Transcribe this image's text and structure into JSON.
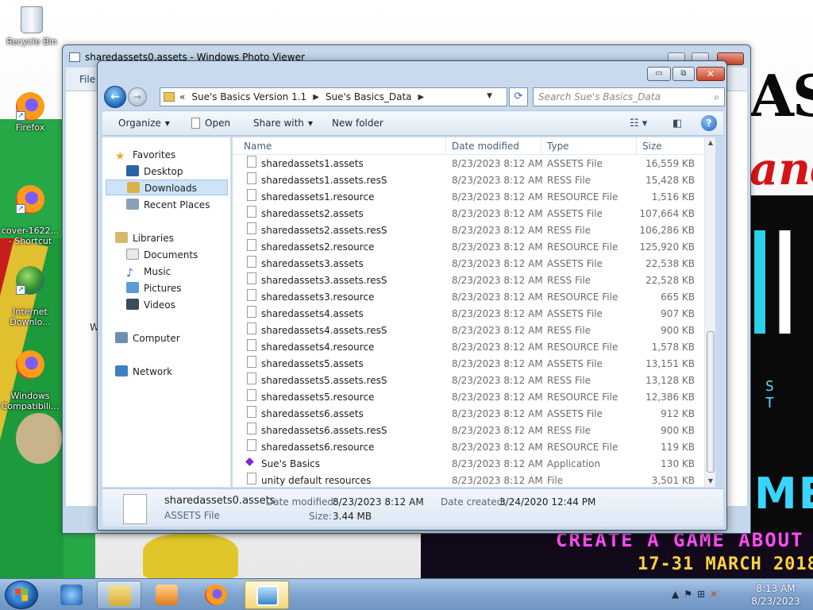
{
  "desktop": {
    "icons": [
      {
        "label": "Recycle Bin"
      },
      {
        "label": "Firefox"
      },
      {
        "label": "cover-1622...\n- Shortcut"
      },
      {
        "label": "Internet\nDownlo..."
      },
      {
        "label": "Windows\nCompatibili..."
      }
    ],
    "wallpaper_text": {
      "line1": "AS",
      "line2": "and",
      "letters": "S T",
      "me": "ME",
      "banner1": "CREATE A GAME ABOUT",
      "banner2": "17-31 MARCH 2018"
    }
  },
  "photo_viewer": {
    "title": "sharedassets0.assets - Windows Photo Viewer",
    "menu_file": "File",
    "partial_label": "W"
  },
  "explorer": {
    "window_buttons": {
      "minimize": "▭",
      "maximize": "⧉",
      "close": "✕"
    },
    "address": {
      "overflow": "«",
      "crumbs": [
        "Sue's Basics Version 1.1",
        "Sue's Basics_Data"
      ]
    },
    "search_placeholder": "Search Sue's Basics_Data",
    "toolbar": {
      "organize": "Organize",
      "open": "Open",
      "share_with": "Share with",
      "new_folder": "New folder"
    },
    "nav": {
      "favorites": "Favorites",
      "desktop": "Desktop",
      "downloads": "Downloads",
      "recent": "Recent Places",
      "libraries": "Libraries",
      "documents": "Documents",
      "music": "Music",
      "pictures": "Pictures",
      "videos": "Videos",
      "computer": "Computer",
      "network": "Network"
    },
    "columns": {
      "name": "Name",
      "date": "Date modified",
      "type": "Type",
      "size": "Size"
    },
    "files": [
      {
        "name": "sharedassets1.assets",
        "date": "8/23/2023 8:12 AM",
        "type": "ASSETS File",
        "size": "16,559 KB"
      },
      {
        "name": "sharedassets1.assets.resS",
        "date": "8/23/2023 8:12 AM",
        "type": "RESS File",
        "size": "15,428 KB"
      },
      {
        "name": "sharedassets1.resource",
        "date": "8/23/2023 8:12 AM",
        "type": "RESOURCE File",
        "size": "1,516 KB"
      },
      {
        "name": "sharedassets2.assets",
        "date": "8/23/2023 8:12 AM",
        "type": "ASSETS File",
        "size": "107,664 KB"
      },
      {
        "name": "sharedassets2.assets.resS",
        "date": "8/23/2023 8:12 AM",
        "type": "RESS File",
        "size": "106,286 KB"
      },
      {
        "name": "sharedassets2.resource",
        "date": "8/23/2023 8:12 AM",
        "type": "RESOURCE File",
        "size": "125,920 KB"
      },
      {
        "name": "sharedassets3.assets",
        "date": "8/23/2023 8:12 AM",
        "type": "ASSETS File",
        "size": "22,538 KB"
      },
      {
        "name": "sharedassets3.assets.resS",
        "date": "8/23/2023 8:12 AM",
        "type": "RESS File",
        "size": "22,528 KB"
      },
      {
        "name": "sharedassets3.resource",
        "date": "8/23/2023 8:12 AM",
        "type": "RESOURCE File",
        "size": "665 KB"
      },
      {
        "name": "sharedassets4.assets",
        "date": "8/23/2023 8:12 AM",
        "type": "ASSETS File",
        "size": "907 KB"
      },
      {
        "name": "sharedassets4.assets.resS",
        "date": "8/23/2023 8:12 AM",
        "type": "RESS File",
        "size": "900 KB"
      },
      {
        "name": "sharedassets4.resource",
        "date": "8/23/2023 8:12 AM",
        "type": "RESOURCE File",
        "size": "1,578 KB"
      },
      {
        "name": "sharedassets5.assets",
        "date": "8/23/2023 8:12 AM",
        "type": "ASSETS File",
        "size": "13,151 KB"
      },
      {
        "name": "sharedassets5.assets.resS",
        "date": "8/23/2023 8:12 AM",
        "type": "RESS File",
        "size": "13,128 KB"
      },
      {
        "name": "sharedassets5.resource",
        "date": "8/23/2023 8:12 AM",
        "type": "RESOURCE File",
        "size": "12,386 KB"
      },
      {
        "name": "sharedassets6.assets",
        "date": "8/23/2023 8:12 AM",
        "type": "ASSETS File",
        "size": "912 KB"
      },
      {
        "name": "sharedassets6.assets.resS",
        "date": "8/23/2023 8:12 AM",
        "type": "RESS File",
        "size": "900 KB"
      },
      {
        "name": "sharedassets6.resource",
        "date": "8/23/2023 8:12 AM",
        "type": "RESOURCE File",
        "size": "119 KB"
      },
      {
        "name": "Sue's Basics",
        "date": "8/23/2023 8:12 AM",
        "type": "Application",
        "size": "130 KB"
      },
      {
        "name": "unity default resources",
        "date": "8/23/2023 8:12 AM",
        "type": "File",
        "size": "3,501 KB"
      }
    ],
    "details": {
      "filename": "sharedassets0.assets",
      "filetype": "ASSETS File",
      "date_modified_label": "Date modified:",
      "date_modified": "8/23/2023 8:12 AM",
      "date_created_label": "Date created:",
      "date_created": "3/24/2020 12:44 PM",
      "size_label": "Size:",
      "size": "3.44 MB"
    }
  },
  "taskbar": {
    "time": "8:13 AM",
    "date": "8/23/2023"
  }
}
